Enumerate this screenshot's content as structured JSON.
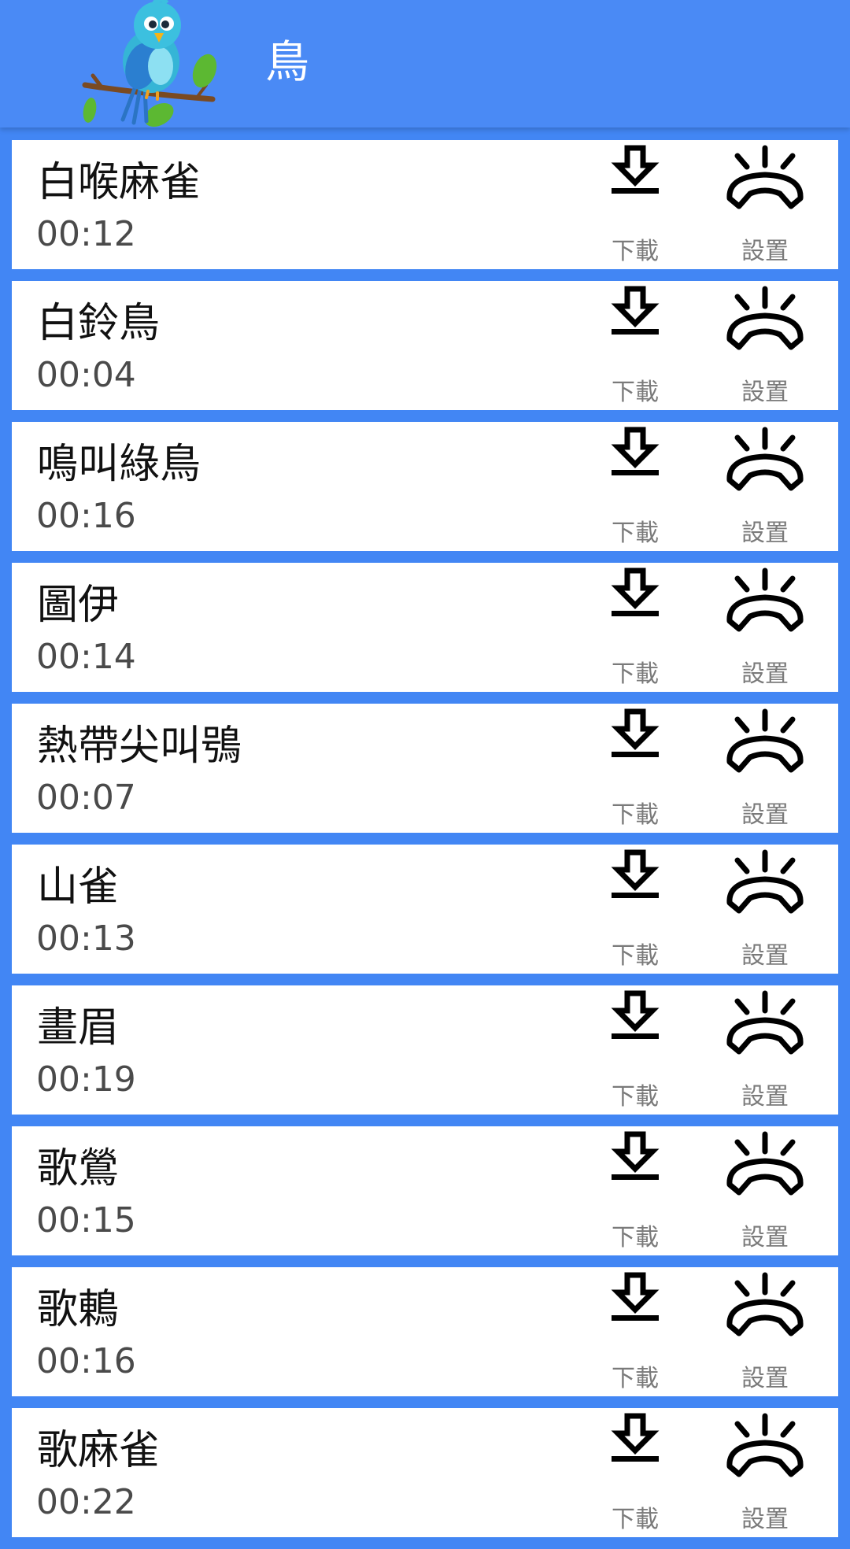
{
  "header": {
    "title": "鳥",
    "logo": "bird-on-branch-icon"
  },
  "actions": {
    "download_label": "下載",
    "setting_label": "設置",
    "download_icon": "download-icon",
    "setting_icon": "ringtone-phone-icon"
  },
  "colors": {
    "background": "#4286f4",
    "app_bar": "#4a8af5",
    "row_background": "#ffffff"
  },
  "items": [
    {
      "name": "白喉麻雀",
      "duration": "00:12"
    },
    {
      "name": "白鈴鳥",
      "duration": "00:04"
    },
    {
      "name": "鳴叫綠鳥",
      "duration": "00:16"
    },
    {
      "name": "圖伊",
      "duration": "00:14"
    },
    {
      "name": "熱帶尖叫鴞",
      "duration": "00:07"
    },
    {
      "name": "山雀",
      "duration": "00:13"
    },
    {
      "name": "畫眉",
      "duration": "00:19"
    },
    {
      "name": "歌鶯",
      "duration": "00:15"
    },
    {
      "name": "歌鶇",
      "duration": "00:16"
    },
    {
      "name": "歌麻雀",
      "duration": "00:22"
    }
  ]
}
